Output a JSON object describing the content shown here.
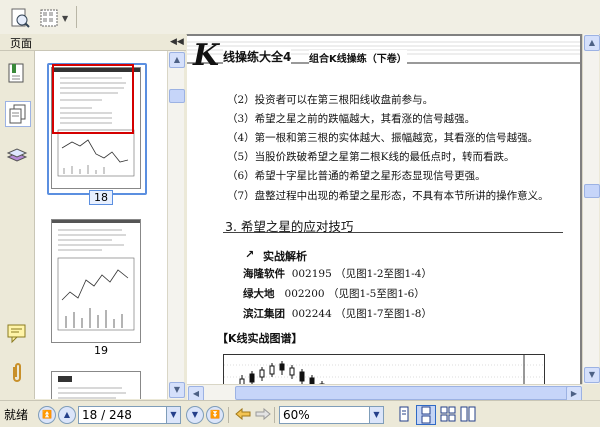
{
  "toolbar": {
    "buttons": [
      "zoom-tool",
      "snapshot-tool"
    ]
  },
  "panel": {
    "title": "页面",
    "thumbnails": [
      {
        "label": "18",
        "selected": true
      },
      {
        "label": "19",
        "selected": false
      }
    ]
  },
  "document": {
    "header_logo": "K",
    "header_title": "线操练大全4",
    "header_subtitle": "组合K线操练（下卷）",
    "list_items": [
      "（2）投资者可以在第三根阳线收盘前参与。",
      "（3）希望之星之前的跌幅越大，其看涨的信号越强。",
      "（4）第一根和第三根的实体越大、振幅越宽，其看涨的信号越强。",
      "（5）当股价跌破希望之星第二根K线的最低点时，转而看跌。",
      "（6）希望十字星比普通的希望之星形态显现信号更强。",
      "（7）盘整过程中出现的希望之星形态，不具有本节所讲的操作意义。"
    ],
    "section_title": "3. 希望之星的应对技巧",
    "practice_title": "实战解析",
    "stocks": [
      {
        "name": "海隆软件",
        "code": "002195",
        "ref": "（见图1-2至图1-4）"
      },
      {
        "name": "绿大地",
        "code": "002200",
        "ref": "（见图1-5至图1-6）"
      },
      {
        "name": "滨江集团",
        "code": "002244",
        "ref": "（见图1-7至图1-8）"
      }
    ],
    "chart_caption": "【K线实战图谱】"
  },
  "status": {
    "ready": "就绪",
    "page_field": "18 / 248",
    "zoom_field": "60%"
  },
  "colors": {
    "selection": "#2f6fd8",
    "highlight_red": "#d40000",
    "page_bg": "#ffffff",
    "chrome": "#ece9d8"
  }
}
